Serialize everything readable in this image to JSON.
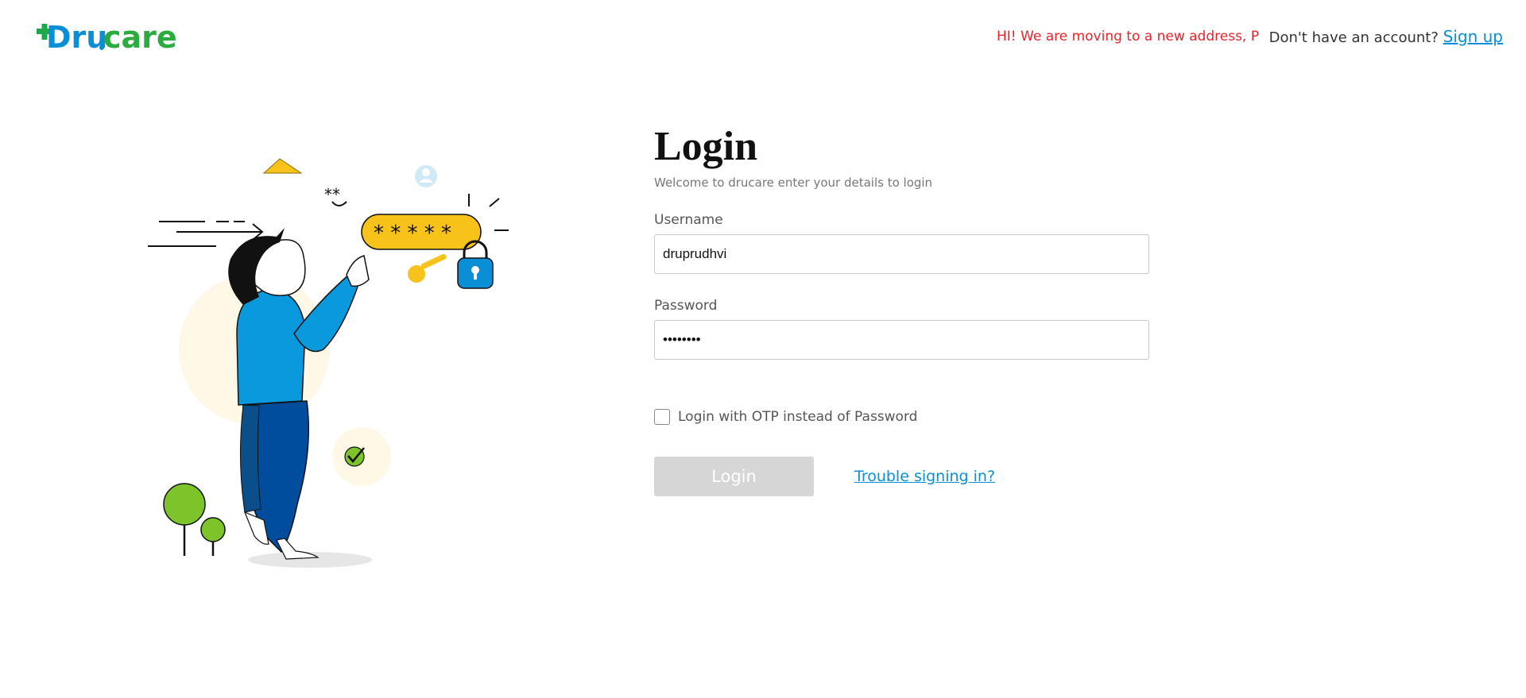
{
  "header": {
    "logo_text": "Drucare",
    "notice": "HI! We are moving to a new address, Please",
    "account_prompt": "Don't have an account?",
    "signup_link": "Sign up"
  },
  "login": {
    "title": "Login",
    "subtitle": "Welcome to drucare enter your details to login",
    "username_label": "Username",
    "username_value": "druprudhvi",
    "password_label": "Password",
    "password_value": "••••••••",
    "otp_label": "Login with OTP instead of Password",
    "otp_checked": false,
    "login_button": "Login",
    "trouble_link": "Trouble signing in?"
  },
  "colors": {
    "brand_blue": "#0a8fd6",
    "brand_green": "#7cc42a",
    "notice_red": "#e8242b",
    "button_disabled": "#d6d6d6"
  }
}
